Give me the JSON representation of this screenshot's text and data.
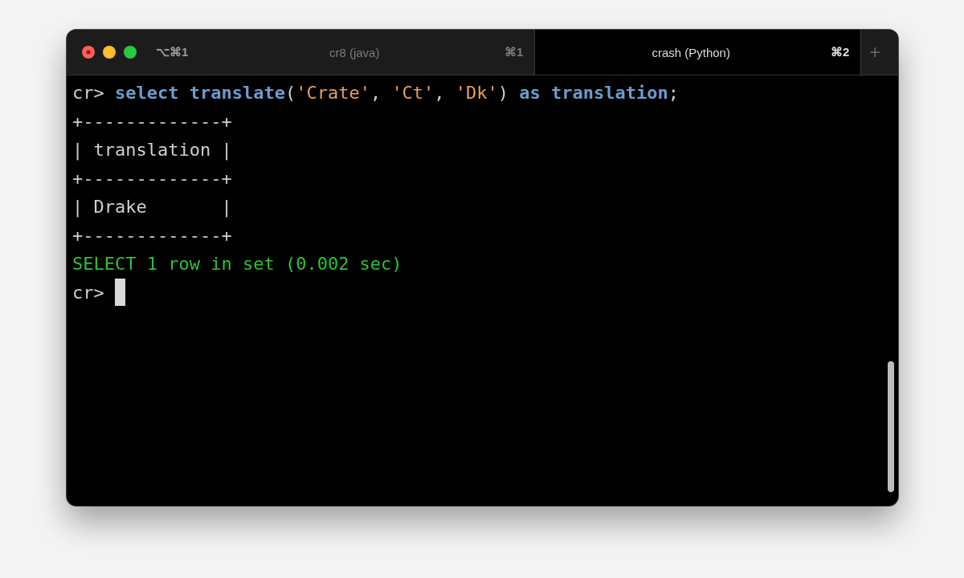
{
  "window": {
    "shortcut": "⌥⌘1"
  },
  "tabs": [
    {
      "label": "cr8 (java)",
      "shortcut": "⌘1",
      "selected": false
    },
    {
      "label": "crash (Python)",
      "shortcut": "⌘2",
      "selected": true
    }
  ],
  "new_tab": "+",
  "terminal": {
    "lines": [
      {
        "segments": [
          {
            "text": "cr> ",
            "kind": "prompt"
          },
          {
            "text": "select translate",
            "kind": "keyword"
          },
          {
            "text": "(",
            "kind": "plain"
          },
          {
            "text": "'Crate'",
            "kind": "string"
          },
          {
            "text": ", ",
            "kind": "plain"
          },
          {
            "text": "'Ct'",
            "kind": "string"
          },
          {
            "text": ", ",
            "kind": "plain"
          },
          {
            "text": "'Dk'",
            "kind": "string"
          },
          {
            "text": ") ",
            "kind": "plain"
          },
          {
            "text": "as translation",
            "kind": "keyword"
          },
          {
            "text": ";",
            "kind": "plain"
          }
        ]
      },
      {
        "segments": [
          {
            "text": "+-------------+",
            "kind": "plain"
          }
        ]
      },
      {
        "segments": [
          {
            "text": "| translation |",
            "kind": "plain"
          }
        ]
      },
      {
        "segments": [
          {
            "text": "+-------------+",
            "kind": "plain"
          }
        ]
      },
      {
        "segments": [
          {
            "text": "| Drake       |",
            "kind": "plain"
          }
        ]
      },
      {
        "segments": [
          {
            "text": "+-------------+",
            "kind": "plain"
          }
        ]
      },
      {
        "segments": [
          {
            "text": "SELECT 1 row in set (0.002 sec)",
            "kind": "status"
          }
        ]
      },
      {
        "segments": [
          {
            "text": "cr> ",
            "kind": "prompt"
          }
        ],
        "cursor": true
      }
    ]
  }
}
